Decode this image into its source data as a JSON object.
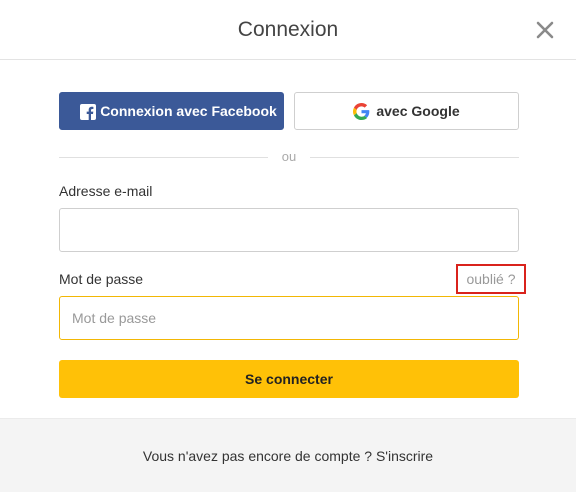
{
  "header": {
    "title": "Connexion",
    "close_icon": "close-icon"
  },
  "social": {
    "facebook_label": "Connexion avec Facebook",
    "facebook_icon": "facebook-icon",
    "google_label": "avec Google",
    "google_icon": "google-icon"
  },
  "divider": {
    "text": "ou"
  },
  "email": {
    "label": "Adresse e-mail",
    "value": "",
    "placeholder": ""
  },
  "password": {
    "label": "Mot de passe",
    "value": "",
    "placeholder": "Mot de passe",
    "forgot_label": "oublié ?"
  },
  "submit": {
    "label": "Se connecter"
  },
  "footer": {
    "prompt": "Vous n'avez pas encore de compte ?",
    "signup_label": "S'inscrire"
  },
  "colors": {
    "facebook": "#3b5998",
    "primary": "#ffc107",
    "focus_border": "#f2b705",
    "highlight": "#d9231c"
  }
}
